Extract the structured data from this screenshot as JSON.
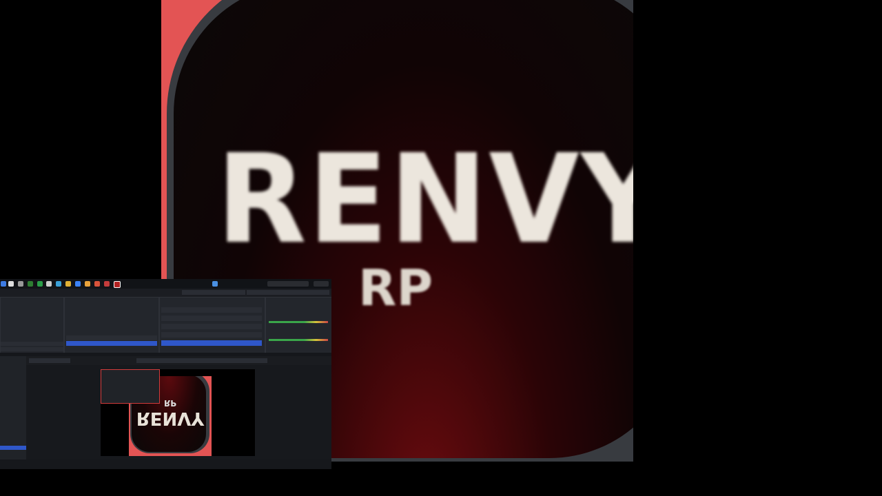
{
  "logo": {
    "title": "RENVY",
    "subtitle": "RP"
  },
  "obs": {
    "mini_logo_title": "RENVY",
    "mini_logo_subtitle": "RP",
    "taskbar_clock": "",
    "colors": {
      "accent": "#2f57c9",
      "logo_red": "#e35454",
      "logo_frame": "#383b40"
    }
  }
}
